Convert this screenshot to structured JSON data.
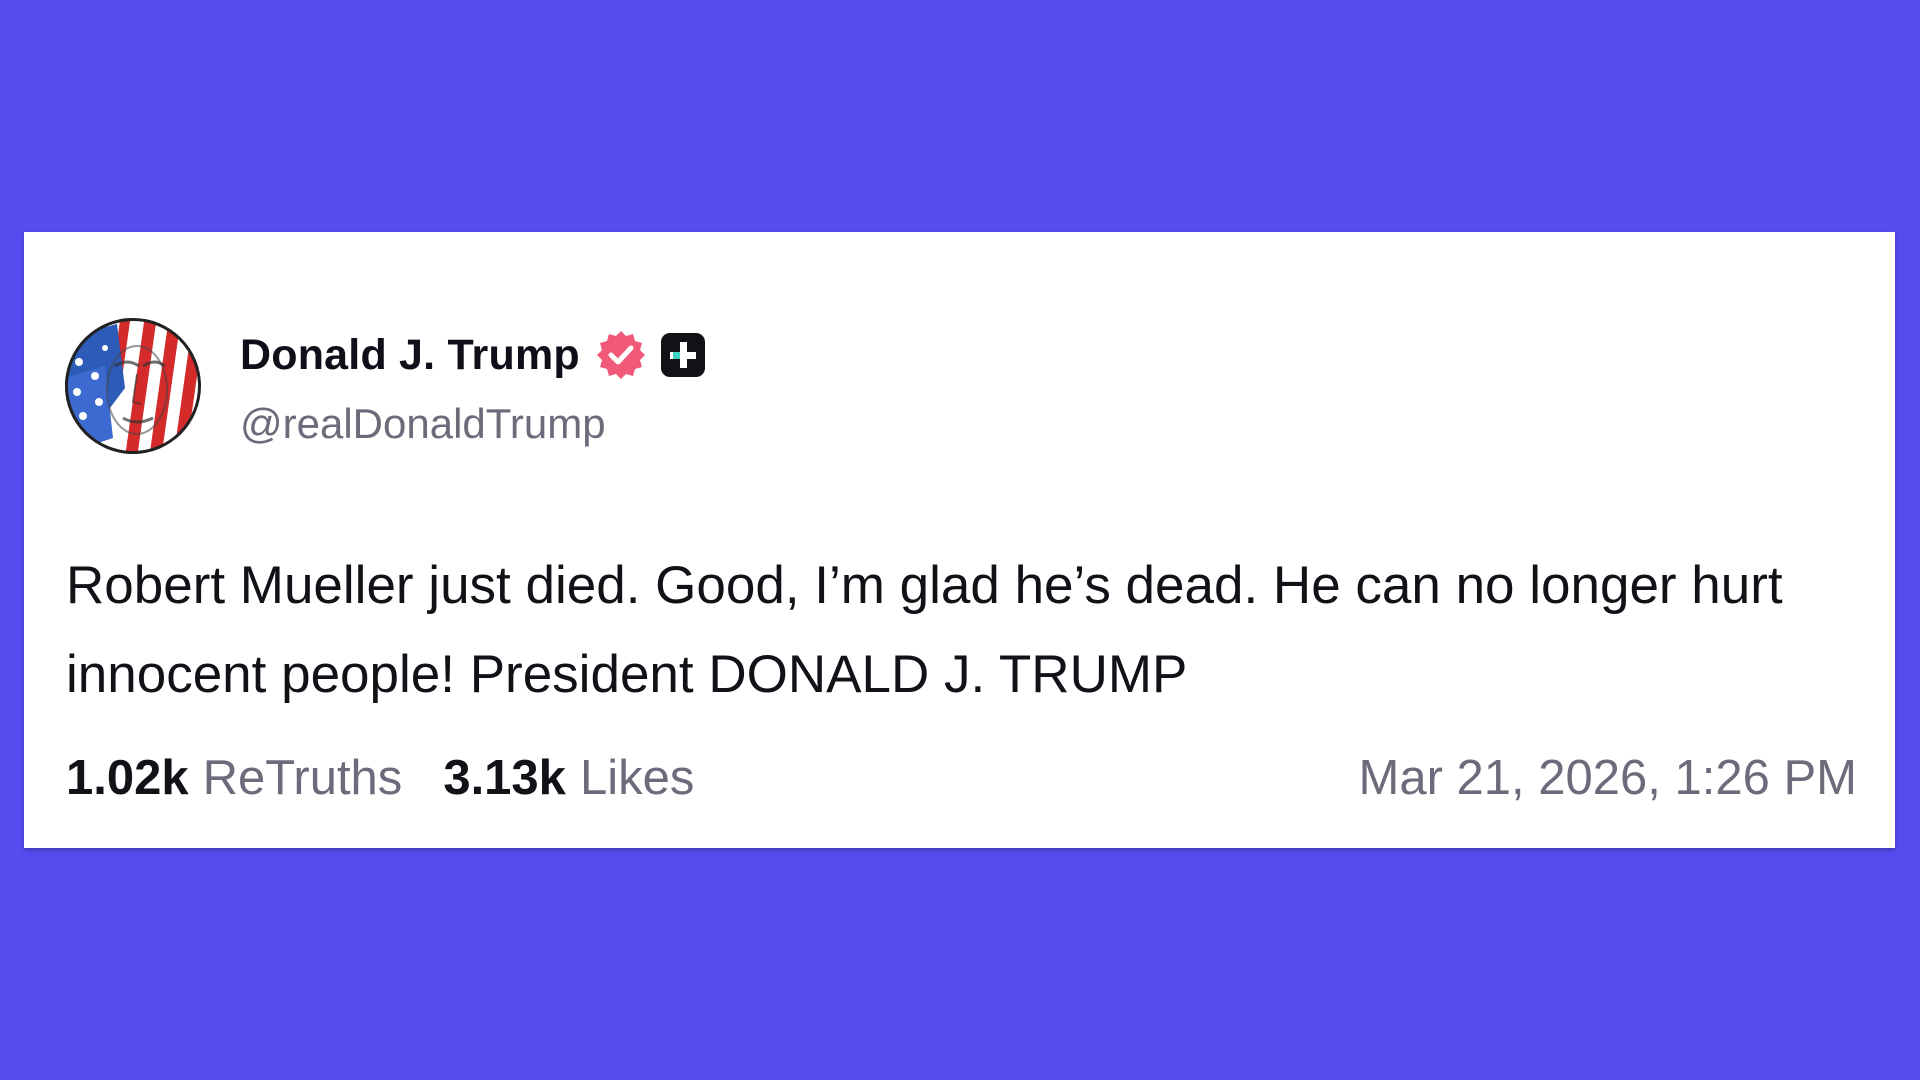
{
  "post": {
    "author": {
      "display_name": "Donald J. Trump",
      "handle": "@realDonaldTrump",
      "verified_badge_icon": "verified-check-icon",
      "plus_badge_icon": "plus-badge-icon",
      "verified_color": "#F25877"
    },
    "body": "Robert Mueller just died. Good, I’m glad he’s dead. He can no longer hurt innocent people! President DONALD J. TRUMP",
    "stats": {
      "retruths_count": "1.02k",
      "retruths_label": "ReTruths",
      "likes_count": "3.13k",
      "likes_label": "Likes"
    },
    "timestamp": "Mar 21, 2026, 1:26 PM"
  },
  "colors": {
    "background": "#554BEF",
    "card": "#FFFFFF",
    "text_primary": "#111118",
    "text_secondary": "#6B6B7B"
  }
}
